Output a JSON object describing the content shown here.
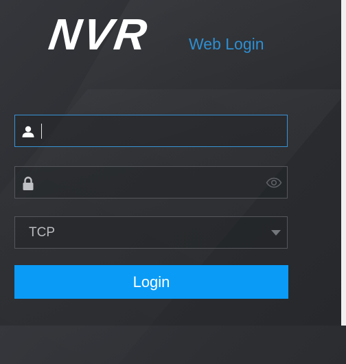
{
  "brand": {
    "logo_text": "NVR",
    "subtitle": "Web Login",
    "subtitle_color": "#2e8fd2"
  },
  "username": {
    "icon": "user-icon",
    "value": "",
    "placeholder": ""
  },
  "password": {
    "icon": "lock-icon",
    "value": "",
    "placeholder": "",
    "toggle_icon": "eye-icon"
  },
  "protocol": {
    "selected": "TCP",
    "icon": "chevron-down-icon"
  },
  "login": {
    "label": "Login",
    "color": "#0a9bf6"
  }
}
